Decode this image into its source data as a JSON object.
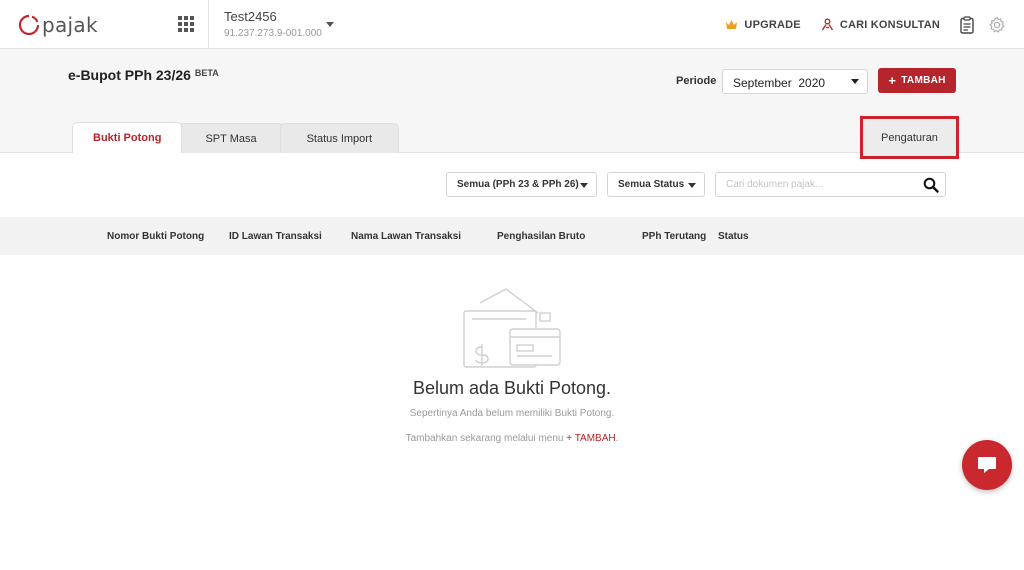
{
  "topbar": {
    "logo_text": "pajak",
    "company_name": "Test2456",
    "company_npwp": "91.237.273.9-001.000",
    "upgrade_label": "UPGRADE",
    "konsultan_label": "CARI KONSULTAN",
    "icons": [
      "apps-grid-icon",
      "crown-icon",
      "consultant-icon",
      "clipboard-icon",
      "gear-icon"
    ],
    "accent_color": "#b5252b"
  },
  "header": {
    "title": "e-Bupot PPh 23/26",
    "badge": "BETA",
    "periode_label": "Periode",
    "periode_value": "September  2020",
    "tambah_label": "TAMBAH",
    "tabs": [
      {
        "label": "Bukti Potong",
        "active": true
      },
      {
        "label": "SPT Masa",
        "active": false
      },
      {
        "label": "Status Import",
        "active": false
      }
    ],
    "pengaturan_label": "Pengaturan"
  },
  "filters": {
    "jenis_value": "Semua (PPh 23 & PPh 26)",
    "status_value": "Semua Status",
    "search_placeholder": "Cari dokumen pajak..."
  },
  "table": {
    "columns": [
      "Nomor Bukti Potong",
      "ID Lawan Transaksi",
      "Nama Lawan Transaksi",
      "Penghasilan Bruto",
      "PPh Terutang",
      "Status"
    ]
  },
  "empty_state": {
    "title": "Belum ada Bukti Potong.",
    "subtitle": "Sepertinya Anda belum memiliki Bukti Potong.",
    "hint_prefix": "Tambahkan sekarang melalui menu ",
    "hint_link": "+ TAMBAH",
    "hint_suffix": "."
  }
}
